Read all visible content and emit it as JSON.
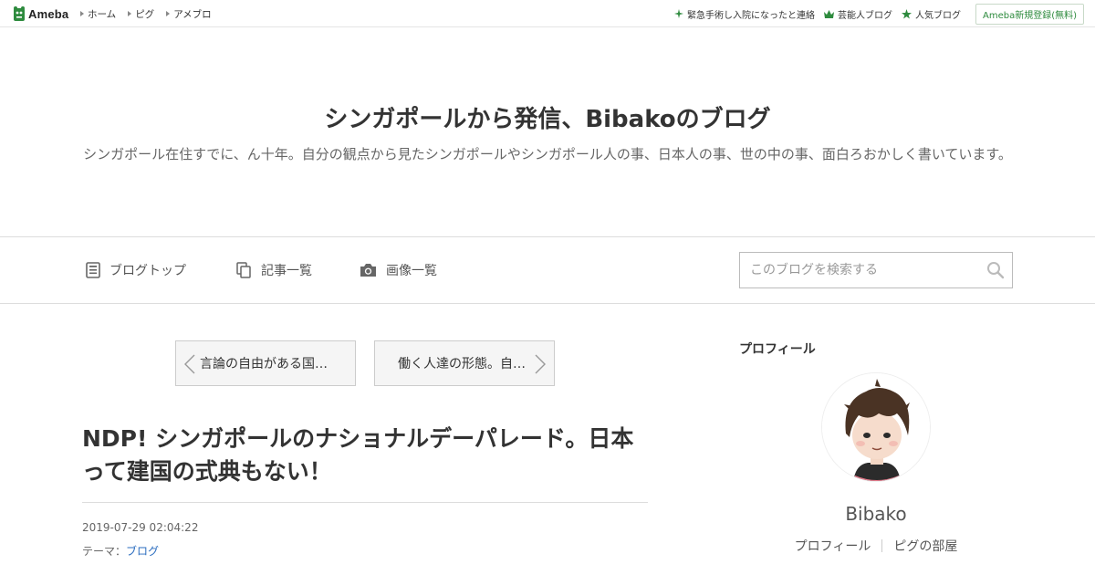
{
  "topbar": {
    "logo_text": "Ameba",
    "nav": [
      "ホーム",
      "ピグ",
      "アメブロ"
    ],
    "right_links": [
      "緊急手術し入院になったと連絡",
      "芸能人ブログ",
      "人気ブログ"
    ],
    "register_label": "Ameba新規登録(無料)",
    "brand_color": "#2e8b3e"
  },
  "header": {
    "title": "シンガポールから発信、Bibakoのブログ",
    "description": "シンガポール在住すでに、ん十年。自分の観点から見たシンガポールやシンガポール人の事、日本人の事、世の中の事、面白ろおかしく書いています。"
  },
  "nav": {
    "blog_top": "ブログトップ",
    "article_list": "記事一覧",
    "image_list": "画像一覧",
    "search_placeholder": "このブログを検索する"
  },
  "article": {
    "prev_label": "言論の自由がある国…",
    "next_label": "働く人達の形態。自…",
    "title": "NDP! シンガポールのナショナルデーパレード。日本って建国の式典もない！",
    "date": "2019-07-29 02:04:22",
    "theme_label": "テーマ：",
    "theme": "ブログ"
  },
  "sidebar": {
    "heading": "プロフィール",
    "name": "Bibako",
    "links": [
      "プロフィール",
      "ピグの部屋"
    ]
  }
}
